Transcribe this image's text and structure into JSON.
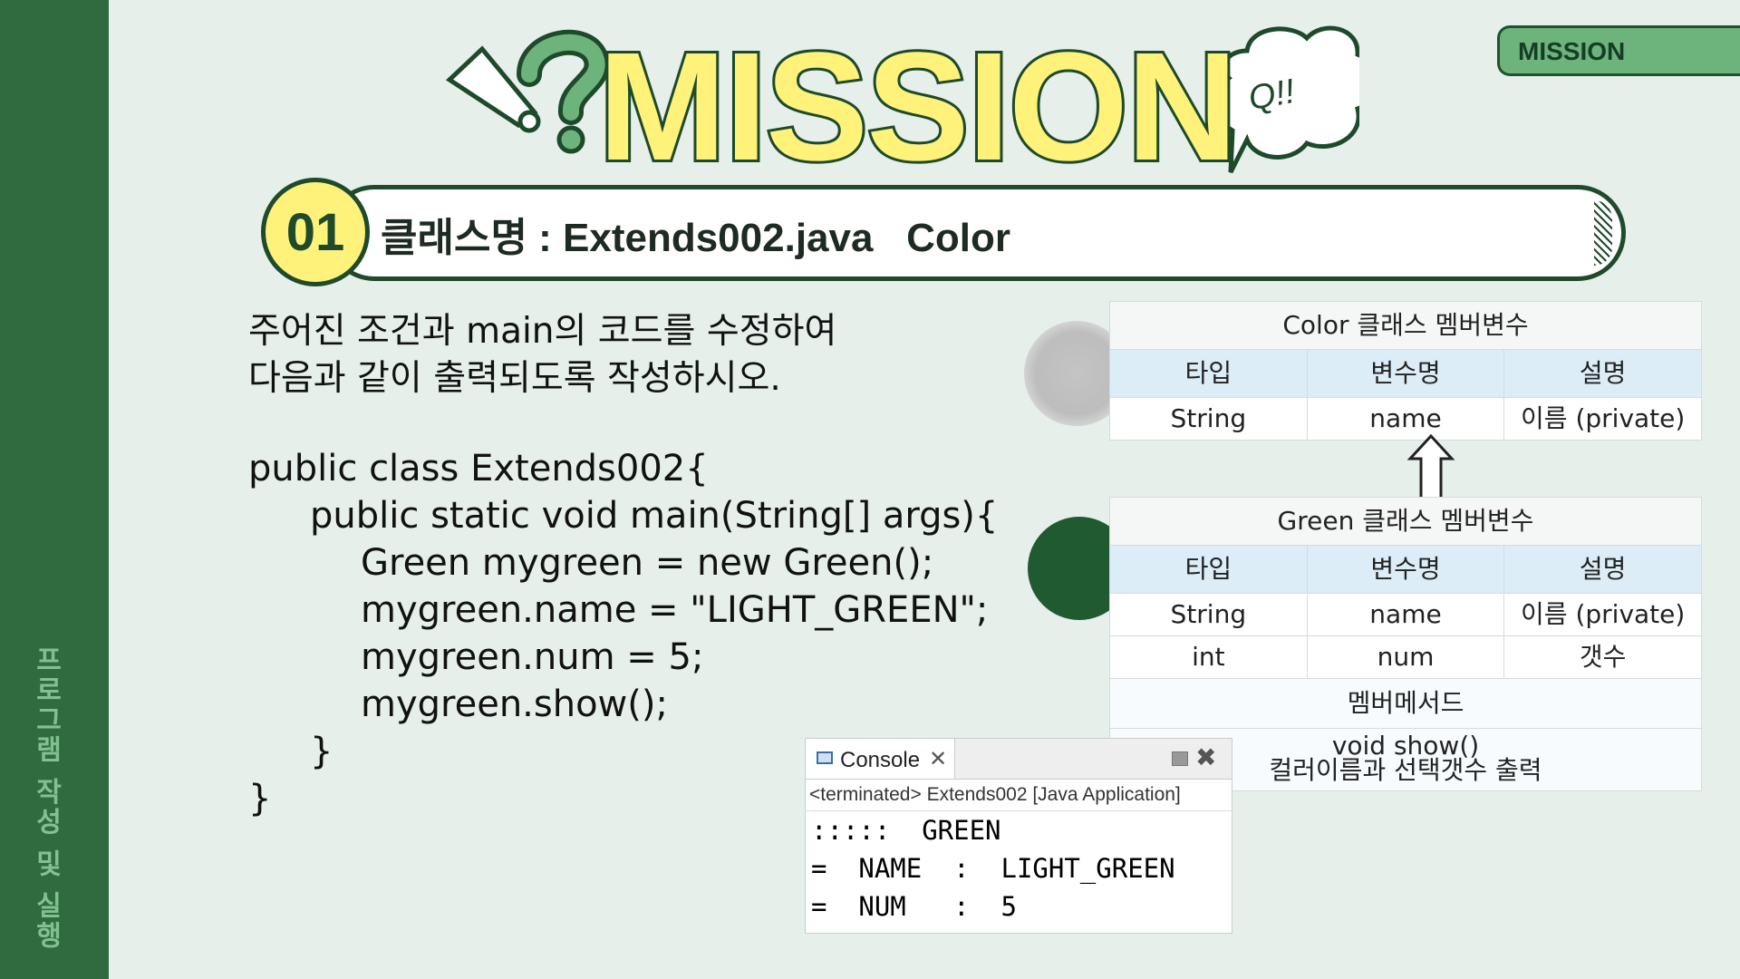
{
  "sidebar": {
    "label": "프로그램 작성 및 실행"
  },
  "tag": {
    "label": "MISSION"
  },
  "banner": {
    "title": "MISSION",
    "bubble_text": "Q!!"
  },
  "headline": {
    "number": "01",
    "text": "클래스명 : Extends002.java   Color"
  },
  "instructions": [
    "주어진 조건과  main의 코드를 수정하여",
    "다음과 같이 출력되도록 작성하시오."
  ],
  "code": [
    "public class Extends002{",
    "public static void main(String[] args){",
    "Green mygreen = new Green();",
    "mygreen.name = \"LIGHT_GREEN\";",
    "mygreen.num = 5;",
    "mygreen.show();",
    "}",
    "}"
  ],
  "color_table": {
    "title": "Color 클래스 멤버변수",
    "headers": [
      "타입",
      "변수명",
      "설명"
    ],
    "rows": [
      [
        "String",
        "name",
        "이름  (private)"
      ]
    ]
  },
  "green_table": {
    "title": "Green 클래스 멤버변수",
    "headers": [
      "타입",
      "변수명",
      "설명"
    ],
    "rows": [
      [
        "String",
        "name",
        "이름  (private)"
      ],
      [
        "int",
        "num",
        "갯수"
      ]
    ],
    "method_header": "멤버메서드",
    "method_name": "void show()",
    "method_desc": "컬러이름과 선택갯수 출력"
  },
  "console": {
    "tab_label": "Console",
    "status": "<terminated> Extends002 [Java Application]",
    "lines": [
      ":::::  GREEN",
      "=  NAME  :  LIGHT_GREEN",
      "=  NUM   :  5"
    ]
  },
  "colors": {
    "sidebar": "#2f6b3e",
    "banner_fill": "#fff27a",
    "banner_stroke": "#1d4a2a",
    "table_header": "#dcedf7",
    "accent_green": "#1f5a31"
  }
}
